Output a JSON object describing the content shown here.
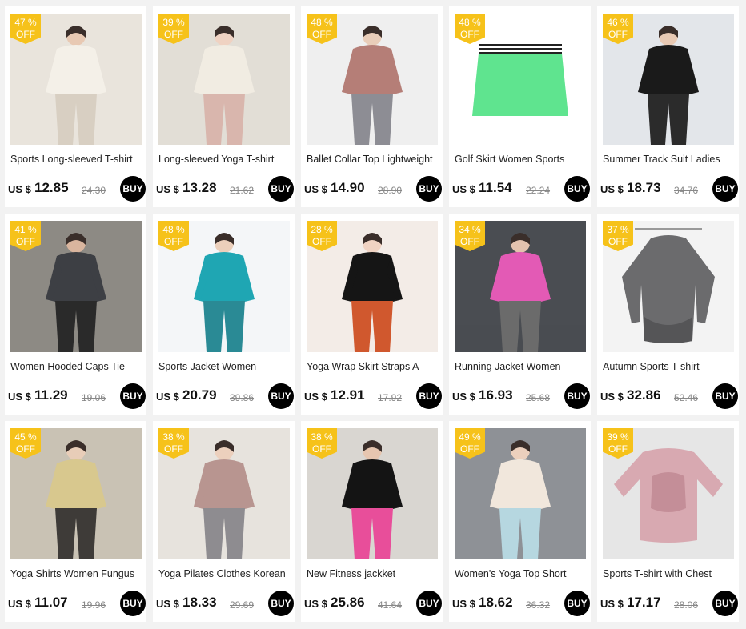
{
  "currency_label": "US $",
  "buy_label": "BUY",
  "off_label": "OFF",
  "products": [
    {
      "title": "Sports Long-sleeved T-shirt",
      "discount": "47 %",
      "price": "12.85",
      "old_price": "24.30",
      "colors": {
        "bg": "#e9e4dc",
        "main": "#f4f0e8",
        "accent": "#d8cfc2",
        "skin": "#e8c9b3"
      }
    },
    {
      "title": "Long-sleeved Yoga T-shirt",
      "discount": "39 %",
      "price": "13.28",
      "old_price": "21.62",
      "colors": {
        "bg": "#e2ded6",
        "main": "#f1ece2",
        "accent": "#d9b6ad",
        "skin": "#efd2c2"
      }
    },
    {
      "title": "Ballet Collar Top Lightweight",
      "discount": "48 %",
      "price": "14.90",
      "old_price": "28.90",
      "colors": {
        "bg": "#efefef",
        "main": "#b57e77",
        "accent": "#8d8d94",
        "skin": "#e9cdb9"
      }
    },
    {
      "title": "Golf Skirt Women Sports",
      "discount": "48 %",
      "price": "11.54",
      "old_price": "22.24",
      "colors": {
        "bg": "#ffffff",
        "main": "#5fe48f",
        "accent": "#222222",
        "skin": "#ffffff"
      }
    },
    {
      "title": "Summer Track Suit Ladies",
      "discount": "46 %",
      "price": "18.73",
      "old_price": "34.76",
      "colors": {
        "bg": "#e3e6ea",
        "main": "#1a1a1a",
        "accent": "#2b2b2b",
        "skin": "#e8c9b3"
      }
    },
    {
      "title": "Women Hooded Caps Tie",
      "discount": "41 %",
      "price": "11.29",
      "old_price": "19.06",
      "colors": {
        "bg": "#8d8a84",
        "main": "#3d3f44",
        "accent": "#2a2a2a",
        "skin": "#d9b59e"
      }
    },
    {
      "title": "Sports Jacket Women",
      "discount": "48 %",
      "price": "20.79",
      "old_price": "39.86",
      "colors": {
        "bg": "#f4f6f8",
        "main": "#1fa6b3",
        "accent": "#2a8a95",
        "skin": "#ebcfbb"
      }
    },
    {
      "title": "Yoga Wrap Skirt Straps A",
      "discount": "28 %",
      "price": "12.91",
      "old_price": "17.92",
      "colors": {
        "bg": "#f3ece7",
        "main": "#151515",
        "accent": "#d0582e",
        "skin": "#f0d3c3"
      }
    },
    {
      "title": "Running Jacket Women",
      "discount": "34 %",
      "price": "16.93",
      "old_price": "25.68",
      "colors": {
        "bg": "#4a4d52",
        "main": "#e35ab5",
        "accent": "#6b6b6b",
        "skin": "#e3c2ae"
      }
    },
    {
      "title": "Autumn Sports T-shirt",
      "discount": "37 %",
      "price": "32.86",
      "old_price": "52.46",
      "colors": {
        "bg": "#f3f3f3",
        "main": "#6b6b6d",
        "accent": "#555557",
        "skin": "#ffffff"
      }
    },
    {
      "title": "Yoga Shirts Women Fungus",
      "discount": "45 %",
      "price": "11.07",
      "old_price": "19.96",
      "colors": {
        "bg": "#c9c2b4",
        "main": "#d8c88e",
        "accent": "#3e3b38",
        "skin": "#e8cdb8"
      }
    },
    {
      "title": "Yoga Pilates Clothes Korean",
      "discount": "38 %",
      "price": "18.33",
      "old_price": "29.69",
      "colors": {
        "bg": "#e7e3dd",
        "main": "#b89590",
        "accent": "#8e8c90",
        "skin": "#ecd0bd"
      }
    },
    {
      "title": "New Fitness jackket",
      "discount": "38 %",
      "price": "25.86",
      "old_price": "41.64",
      "colors": {
        "bg": "#d9d6d1",
        "main": "#141414",
        "accent": "#e84e9a",
        "skin": "#e6c6b0"
      }
    },
    {
      "title": "Women's Yoga Top Short",
      "discount": "49 %",
      "price": "18.62",
      "old_price": "36.32",
      "colors": {
        "bg": "#8e9196",
        "main": "#f1e7dc",
        "accent": "#b6d7e0",
        "skin": "#ecd0bd"
      }
    },
    {
      "title": "Sports T-shirt with Chest",
      "discount": "39 %",
      "price": "17.17",
      "old_price": "28.06",
      "colors": {
        "bg": "#e6e6e6",
        "main": "#d8a9b1",
        "accent": "#c48e98",
        "skin": "#ffffff"
      }
    }
  ]
}
